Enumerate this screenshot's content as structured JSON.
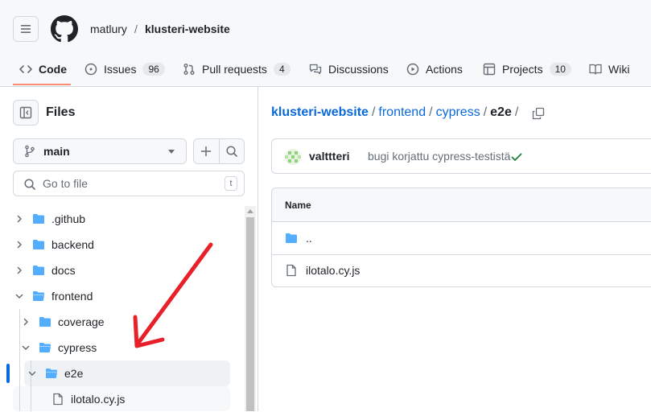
{
  "header": {
    "owner": "matlury",
    "separator": "/",
    "repo": "klusteri-website"
  },
  "tabs": [
    {
      "label": "Code",
      "count": null
    },
    {
      "label": "Issues",
      "count": "96"
    },
    {
      "label": "Pull requests",
      "count": "4"
    },
    {
      "label": "Discussions",
      "count": null
    },
    {
      "label": "Actions",
      "count": null
    },
    {
      "label": "Projects",
      "count": "10"
    },
    {
      "label": "Wiki",
      "count": null
    }
  ],
  "sidebar": {
    "title": "Files",
    "branch": "main",
    "search_placeholder": "Go to file",
    "shortcut": "t",
    "tree": [
      {
        "label": ".github",
        "type": "folder",
        "expanded": false
      },
      {
        "label": "backend",
        "type": "folder",
        "expanded": false
      },
      {
        "label": "docs",
        "type": "folder",
        "expanded": false
      },
      {
        "label": "frontend",
        "type": "folder",
        "expanded": true
      },
      {
        "label": "coverage",
        "type": "folder",
        "expanded": false
      },
      {
        "label": "cypress",
        "type": "folder",
        "expanded": true
      },
      {
        "label": "e2e",
        "type": "folder",
        "expanded": true,
        "selected": true
      },
      {
        "label": "ilotalo.cy.js",
        "type": "file"
      }
    ]
  },
  "main": {
    "breadcrumb": {
      "repo": "klusteri-website",
      "p1": "frontend",
      "p2": "cypress",
      "current": "e2e",
      "sep": "/"
    },
    "commit": {
      "author": "valttteri",
      "message": "bugi korjattu cypress-testistä"
    },
    "table": {
      "header": "Name",
      "rows": [
        {
          "name": "..",
          "type": "folder"
        },
        {
          "name": "ilotalo.cy.js",
          "type": "file"
        }
      ]
    }
  },
  "colors": {
    "accent": "#0969da",
    "folder": "#54aeff",
    "success": "#1a7f37",
    "annotation": "#e8202a"
  }
}
